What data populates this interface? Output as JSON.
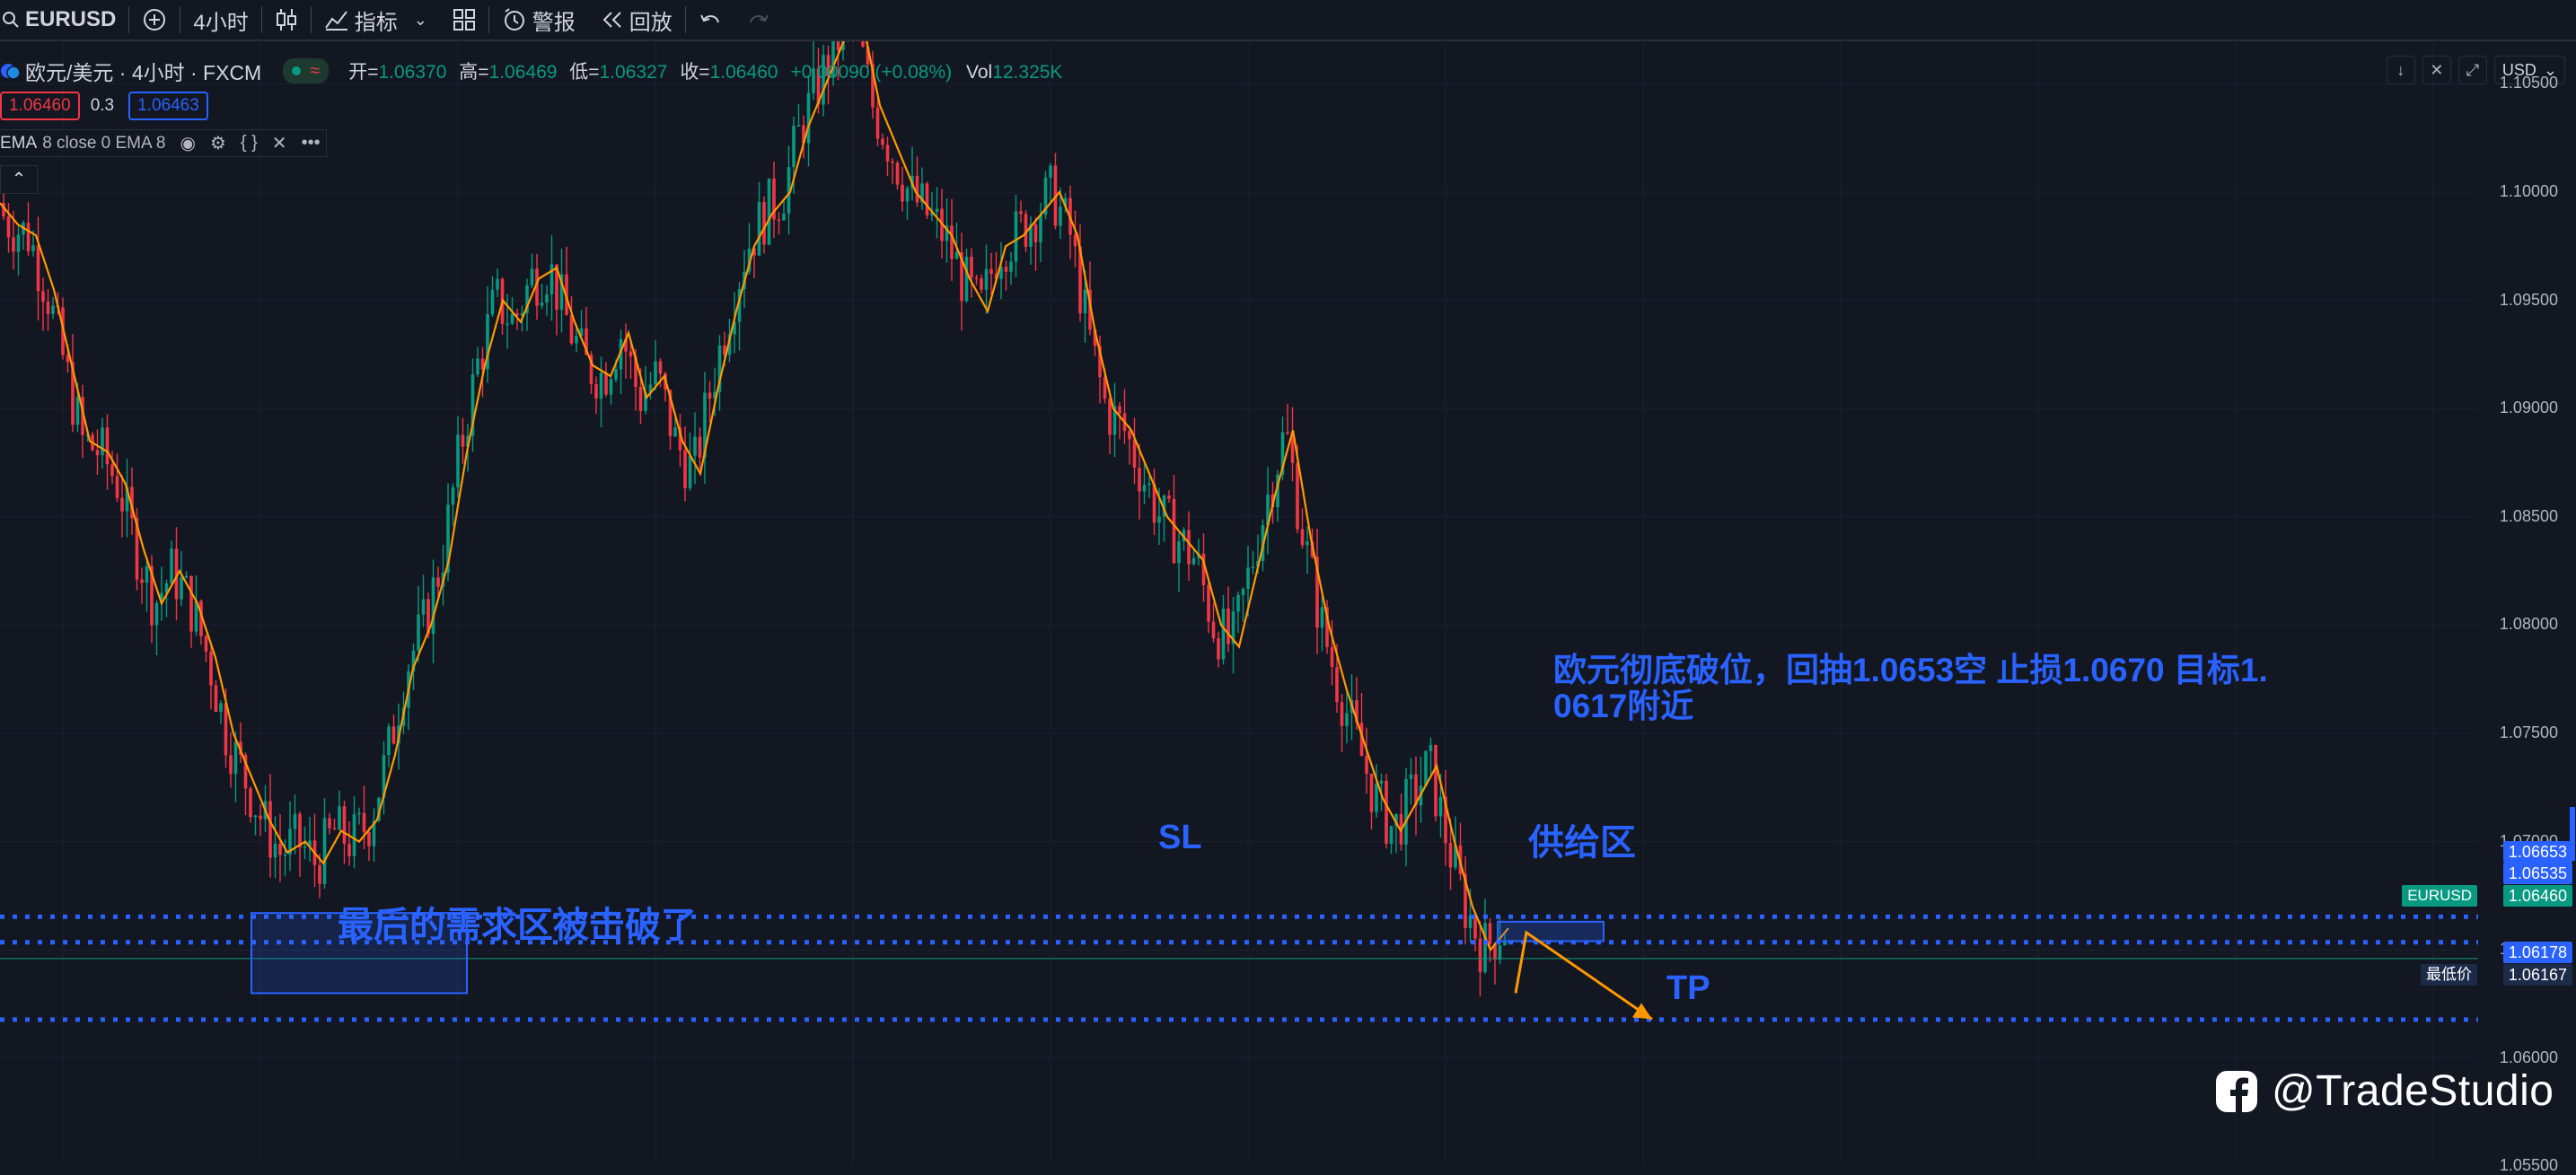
{
  "toolbar": {
    "symbol": "EURUSD",
    "interval": "4小时",
    "indicators": "指标",
    "alerts": "警报",
    "replay": "回放"
  },
  "legend": {
    "title": "欧元/美元 · 4小时 · FXCM",
    "open_label": "开=",
    "open": "1.06370",
    "high_label": "高=",
    "high": "1.06469",
    "low_label": "低=",
    "low": "1.06327",
    "close_label": "收=",
    "close": "1.06460",
    "change": "+0.00090 (+0.08%)",
    "vol_label": "Vol",
    "vol": "12.325K"
  },
  "price_boxes": {
    "sell": "1.06460",
    "spread": "0.3",
    "buy": "1.06463"
  },
  "ema": {
    "name": "EMA",
    "params": "8 close 0 EMA 8"
  },
  "axis": {
    "currency": "USD",
    "ticks": [
      "1.10500",
      "1.10000",
      "1.09500",
      "1.09000",
      "1.08500",
      "1.08000",
      "1.07500",
      "1.07000",
      "1.06500",
      "1.06000",
      "1.05500"
    ]
  },
  "levels": {
    "sl": "1.06653",
    "entry": "1.06535",
    "current_symbol": "EURUSD",
    "current": "1.06460",
    "tp": "1.06178",
    "low_label": "最低价",
    "low": "1.06167"
  },
  "annotations": {
    "title_line1": "欧元彻底破位，回抽1.0653空 止损1.0670 目标1.",
    "title_line2": "0617附近",
    "sl": "SL",
    "supply": "供给区",
    "demand": "最后的需求区被击破了",
    "tp": "TP"
  },
  "watermark": "@TradeStudio",
  "colors": {
    "bg": "#131722",
    "up": "#089981",
    "down": "#f23645",
    "ema": "#ff9800",
    "annotation": "#2962ff"
  },
  "chart_data": {
    "type": "line",
    "title": "欧元/美元 · 4小时 · FXCM",
    "ylabel": "USD",
    "ylim": [
      1.0545,
      1.1065
    ],
    "series": [
      {
        "name": "EMA 8",
        "x": [
          0,
          20,
          40,
          60,
          80,
          100,
          120,
          140,
          160,
          180,
          200,
          220,
          240,
          260,
          280,
          300,
          320,
          340,
          360,
          380,
          400,
          420,
          440,
          460,
          480,
          500,
          520,
          540,
          560,
          580,
          600,
          620,
          640,
          660,
          680,
          700,
          720,
          740,
          760,
          780,
          800,
          820,
          840,
          860,
          880,
          900,
          920,
          940,
          960,
          980,
          1000,
          1020,
          1040,
          1060,
          1080,
          1100,
          1120,
          1140,
          1160,
          1180,
          1200,
          1220,
          1240,
          1260,
          1280,
          1300,
          1320,
          1340,
          1360,
          1380,
          1400,
          1420,
          1440,
          1460,
          1480,
          1500,
          1520,
          1540,
          1560,
          1580,
          1600,
          1620,
          1640,
          1660,
          1680
        ],
        "values": [
          1.0995,
          1.0985,
          1.098,
          1.0955,
          1.092,
          1.0885,
          1.088,
          1.0865,
          1.0835,
          1.081,
          1.0825,
          1.081,
          1.0785,
          1.075,
          1.073,
          1.071,
          1.0695,
          1.07,
          1.069,
          1.0705,
          1.07,
          1.071,
          1.074,
          1.078,
          1.08,
          1.083,
          1.088,
          1.092,
          1.095,
          1.094,
          1.096,
          1.0965,
          1.094,
          1.092,
          1.0915,
          1.0935,
          1.0905,
          1.0915,
          1.0885,
          1.087,
          1.091,
          1.0945,
          1.0975,
          1.099,
          1.1,
          1.103,
          1.105,
          1.107,
          1.108,
          1.104,
          1.102,
          1.1,
          1.099,
          1.098,
          1.096,
          1.0945,
          1.0975,
          1.098,
          1.099,
          1.1,
          1.098,
          1.0935,
          1.09,
          1.089,
          1.087,
          1.085,
          1.084,
          1.083,
          1.08,
          1.079,
          1.0825,
          1.086,
          1.089,
          1.084,
          1.08,
          1.077,
          1.0745,
          1.072,
          1.0705,
          1.072,
          1.0735,
          1.07,
          1.067,
          1.065,
          1.066
        ]
      }
    ],
    "horizontal_lines": [
      1.06653,
      1.06535,
      1.06178
    ],
    "annotations": [
      "SL",
      "供给区",
      "最后的需求区被击破了",
      "TP"
    ]
  }
}
